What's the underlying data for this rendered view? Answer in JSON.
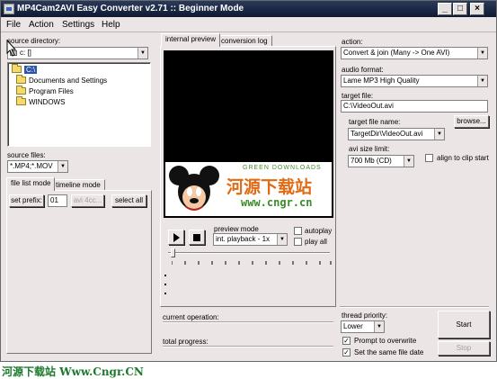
{
  "window": {
    "title": "MP4Cam2AVI Easy Converter v2.71 :: Beginner Mode",
    "buttons": {
      "minimize": "_",
      "maximize": "□",
      "close": "×"
    }
  },
  "menu": [
    "File",
    "Action",
    "Settings",
    "Help"
  ],
  "left": {
    "source_directory_label": "source directory:",
    "drive_value": "c: []",
    "tree": [
      "C:\\",
      "Documents and Settings",
      "Program Files",
      "WINDOWS"
    ],
    "source_files_label": "source files:",
    "file_filter": "*.MP4;*.MOV",
    "tabs": [
      "file list mode",
      "timeline mode"
    ],
    "set_prefix_label": "set prefix:",
    "prefix_value": "01",
    "prefix_preview": "avi 4cc...",
    "select_all_label": "select all"
  },
  "middle": {
    "tabs": [
      "internal preview",
      "conversion log"
    ],
    "watermark_top": "GREEN DOWNLOADS",
    "watermark_cn": "河源下载站",
    "watermark_url": "www.cngr.cn",
    "preview_mode_label": "preview mode",
    "preview_mode_value": "int. playback - 1x",
    "autoplay_label": "autoplay",
    "play_all_label": "play all",
    "current_operation_label": "current operation:",
    "total_progress_label": "total progress:"
  },
  "right": {
    "action_label": "action:",
    "action_value": "Convert & join (Many -> One AVI)",
    "audio_format_label": "audio format:",
    "audio_format_value": "Lame MP3 High Quality",
    "target_file_label": "target file:",
    "target_file_value": "C:\\VideoOut.avi",
    "target_file_name_label": "target file name:",
    "target_file_name_value": "TargetDir\\VideoOut.avi",
    "browse_label": "browse...",
    "avi_size_limit_label": "avi size limit:",
    "avi_size_limit_value": "700 Mb (CD)",
    "align_label": "align to clip start",
    "thread_priority_label": "thread priority:",
    "thread_priority_value": "Lower",
    "prompt_overwrite_label": "Prompt to overwrite",
    "same_date_label": "Set the same file date",
    "start_label": "Start",
    "stop_label": "Stop"
  },
  "footer_watermark": "河源下载站 Www.Cngr.CN"
}
